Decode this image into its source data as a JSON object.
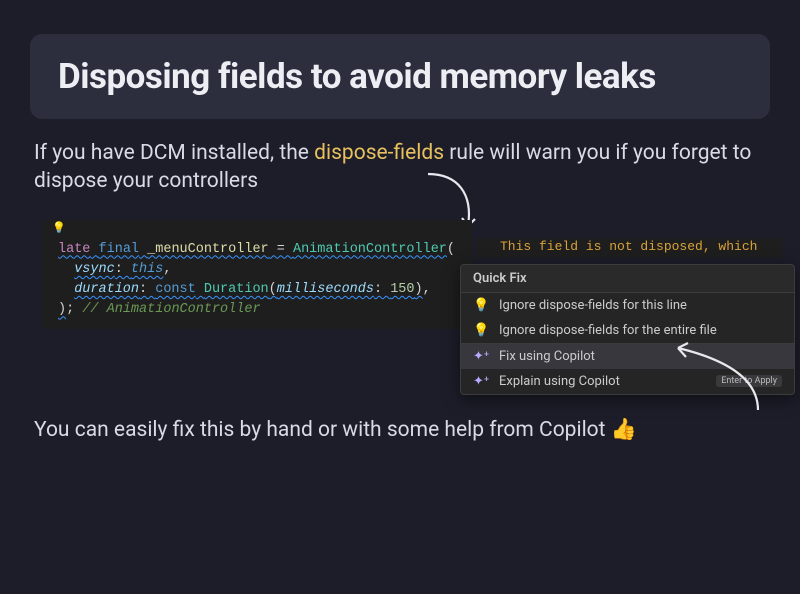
{
  "title": "Disposing fields to avoid memory leaks",
  "subtitle": {
    "pre": "If you have DCM installed, the ",
    "highlight": "dispose-fields",
    "post": " rule will warn you if you forget to dispose your controllers"
  },
  "footer": "You can easily fix this by hand or with some help from Copilot 👍",
  "code": {
    "late": "late",
    "final": "final",
    "ident": "_menuController",
    "eq": " = ",
    "type": "AnimationController",
    "open": "(",
    "vsync_key": "vsync",
    "colon": ": ",
    "this": "this",
    "comma": ",",
    "duration_key": "duration",
    "const": "const",
    "duration_type": "Duration",
    "ms_key": "milliseconds",
    "ms_val": "150",
    "close": ")",
    "semi": ";",
    "comment": "// AnimationController"
  },
  "warning": "This field is not disposed, which",
  "quickfix": {
    "header": "Quick Fix",
    "items": [
      {
        "icon": "💡",
        "label": "Ignore dispose-fields for this line"
      },
      {
        "icon": "💡",
        "label": "Ignore dispose-fields for the entire file"
      },
      {
        "icon": "✦⁺",
        "label": "Fix using Copilot",
        "selected": true
      },
      {
        "icon": "✦⁺",
        "label": "Explain using Copilot",
        "kbd": "Enter to Apply"
      }
    ]
  }
}
